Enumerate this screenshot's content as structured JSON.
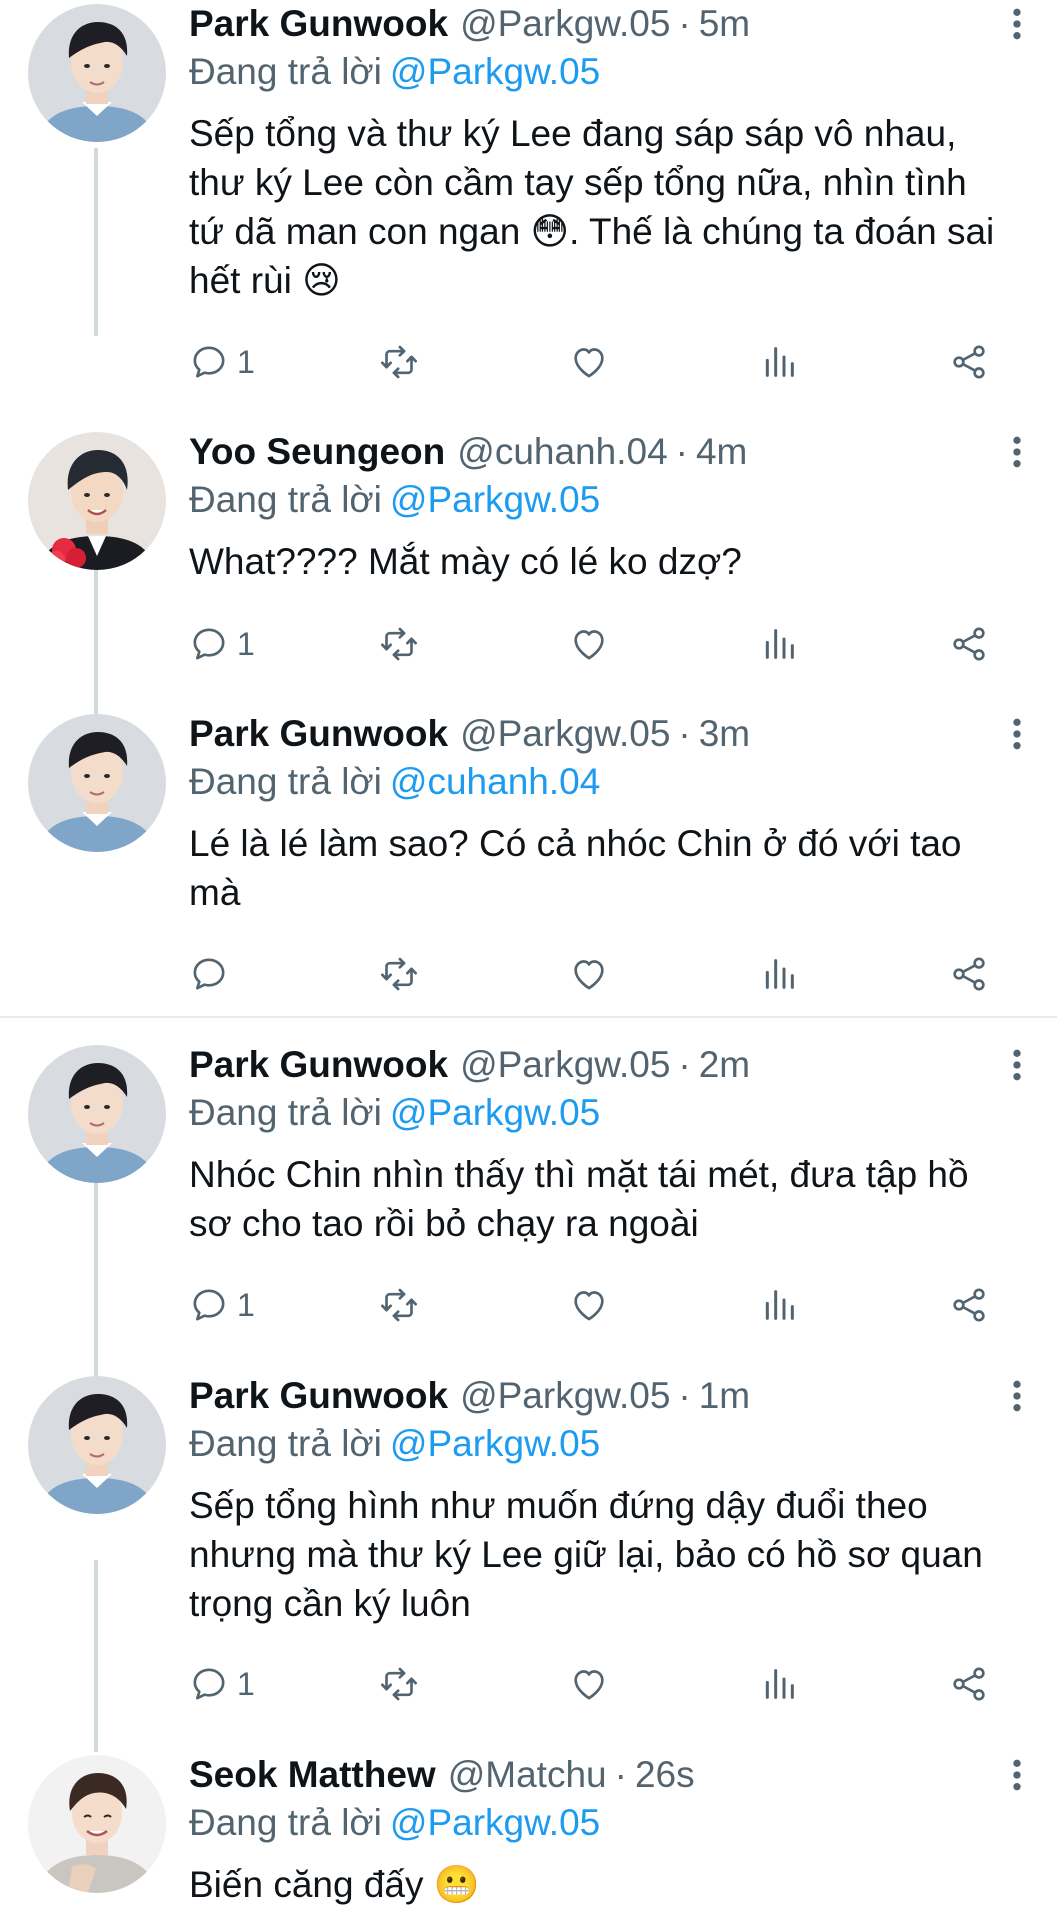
{
  "tweets": [
    {
      "name": "Park Gunwook",
      "handle": "@Parkgw.05",
      "dot": "·",
      "time": "5m",
      "reply_prefix": "Đang trả lời",
      "reply_to": "@Parkgw.05",
      "body": "Sếp tổng và thư ký Lee đang sáp sáp vô nhau, thư ký Lee còn cầm tay sếp tổng nữa, nhìn tình tứ dã man con ngan 😳. Thế là chúng ta đoán sai hết rùi 😢",
      "reply_count": "1",
      "avatar": "avatar-park"
    },
    {
      "name": "Yoo Seungeon",
      "handle": "@cuhanh.04",
      "dot": "·",
      "time": "4m",
      "reply_prefix": "Đang trả lời",
      "reply_to": "@Parkgw.05",
      "body": "What???? Mắt mày có lé ko dzợ?",
      "reply_count": "1",
      "avatar": "avatar-yoo"
    },
    {
      "name": "Park Gunwook",
      "handle": "@Parkgw.05",
      "dot": "·",
      "time": "3m",
      "reply_prefix": "Đang trả lời",
      "reply_to": "@cuhanh.04",
      "body": "Lé là lé làm sao? Có cả nhóc Chin ở đó với tao mà",
      "reply_count": "",
      "avatar": "avatar-park"
    },
    {
      "name": "Park Gunwook",
      "handle": "@Parkgw.05",
      "dot": "·",
      "time": "2m",
      "reply_prefix": "Đang trả lời",
      "reply_to": "@Parkgw.05",
      "body": "Nhóc Chin nhìn thấy thì mặt tái mét, đưa tập hồ sơ cho tao rồi bỏ chạy ra ngoài",
      "reply_count": "1",
      "avatar": "avatar-park"
    },
    {
      "name": "Park Gunwook",
      "handle": "@Parkgw.05",
      "dot": "·",
      "time": "1m",
      "reply_prefix": "Đang trả lời",
      "reply_to": "@Parkgw.05",
      "body": "Sếp tổng hình như muốn đứng dậy đuổi theo nhưng mà thư ký Lee giữ lại, bảo có hồ sơ quan trọng cần ký luôn",
      "reply_count": "1",
      "avatar": "avatar-park"
    },
    {
      "name": "Seok Matthew",
      "handle": "@Matchu",
      "dot": "·",
      "time": "26s",
      "reply_prefix": "Đang trả lời",
      "reply_to": "@Parkgw.05",
      "body": "Biến căng đấy 😬",
      "reply_count": "",
      "avatar": "avatar-seok"
    }
  ],
  "icons": {
    "reply": "reply-icon",
    "retweet": "retweet-icon",
    "like": "heart-icon",
    "views": "views-icon",
    "share": "share-icon",
    "more": "more-vertical-icon"
  },
  "colors": {
    "link": "#1d9bf0",
    "secondary_text": "#536471",
    "thread_line": "#cfd9de"
  }
}
